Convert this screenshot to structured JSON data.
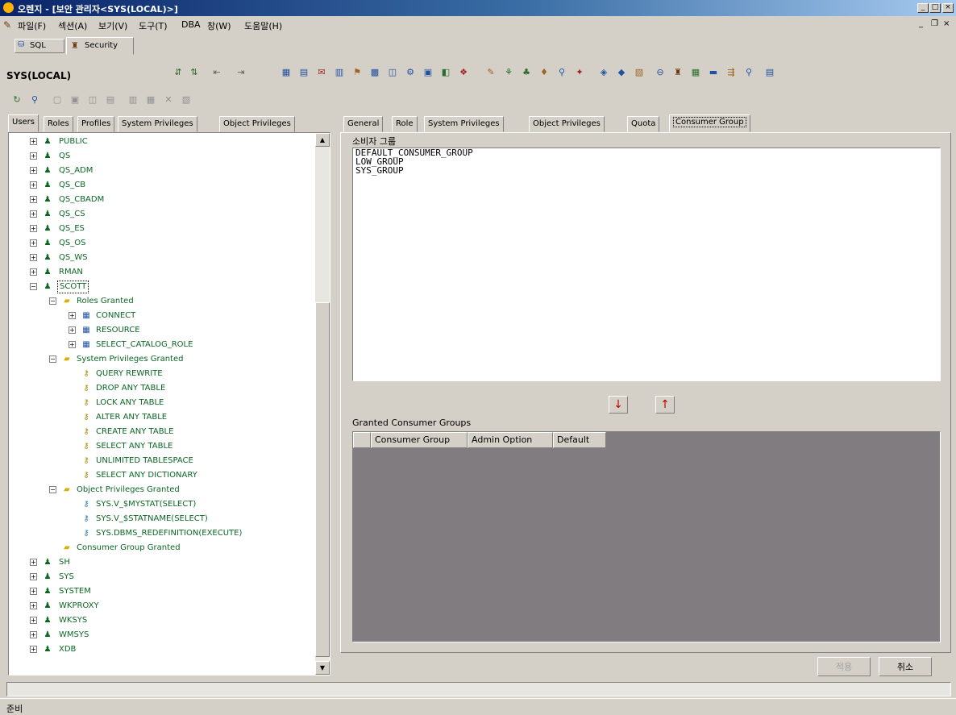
{
  "window": {
    "title": "오렌지 - [보안 관리자<SYS(LOCAL)>]"
  },
  "menubar": {
    "items": [
      "파일(F)",
      "섹션(A)",
      "보기(V)",
      "도구(T)",
      "DBA",
      "창(W)",
      "도움말(H)"
    ]
  },
  "doc_tabs": {
    "items": [
      "SQL",
      "Security"
    ]
  },
  "connection_label": "SYS(LOCAL)",
  "left_tabs": [
    "Users",
    "Roles",
    "Profiles",
    "System Privileges",
    "Object Privileges"
  ],
  "tree": {
    "users_before": [
      "PUBLIC",
      "QS",
      "QS_ADM",
      "QS_CB",
      "QS_CBADM",
      "QS_CS",
      "QS_ES",
      "QS_OS",
      "QS_WS",
      "RMAN"
    ],
    "selected_user": "SCOTT",
    "roles_folder": "Roles Granted",
    "roles": [
      "CONNECT",
      "RESOURCE",
      "SELECT_CATALOG_ROLE"
    ],
    "sysprivs_folder": "System Privileges Granted",
    "sysprivs": [
      "QUERY REWRITE",
      "DROP ANY TABLE",
      "LOCK ANY TABLE",
      "ALTER ANY TABLE",
      "CREATE ANY TABLE",
      "SELECT ANY TABLE",
      "UNLIMITED TABLESPACE",
      "SELECT ANY DICTIONARY"
    ],
    "objprivs_folder": "Object Privileges Granted",
    "objprivs": [
      "SYS.V_$MYSTAT(SELECT)",
      "SYS.V_$STATNAME(SELECT)",
      "SYS.DBMS_REDEFINITION(EXECUTE)"
    ],
    "consumer_folder": "Consumer Group Granted",
    "users_after": [
      "SH",
      "SYS",
      "SYSTEM",
      "WKPROXY",
      "WKSYS",
      "WMSYS",
      "XDB"
    ]
  },
  "right_tabs": [
    "General",
    "Role",
    "System Privileges",
    "Object Privileges",
    "Quota",
    "Consumer Group"
  ],
  "consumer_groups": {
    "label": "소비자 그룹",
    "items": [
      "DEFAULT_CONSUMER_GROUP",
      "LOW_GROUP",
      "SYS_GROUP"
    ]
  },
  "granted": {
    "label": "Granted Consumer Groups",
    "columns": [
      "Consumer Group",
      "Admin Option",
      "Default"
    ]
  },
  "buttons": {
    "apply": "적용",
    "cancel": "취소"
  },
  "status": {
    "text": "준비"
  }
}
